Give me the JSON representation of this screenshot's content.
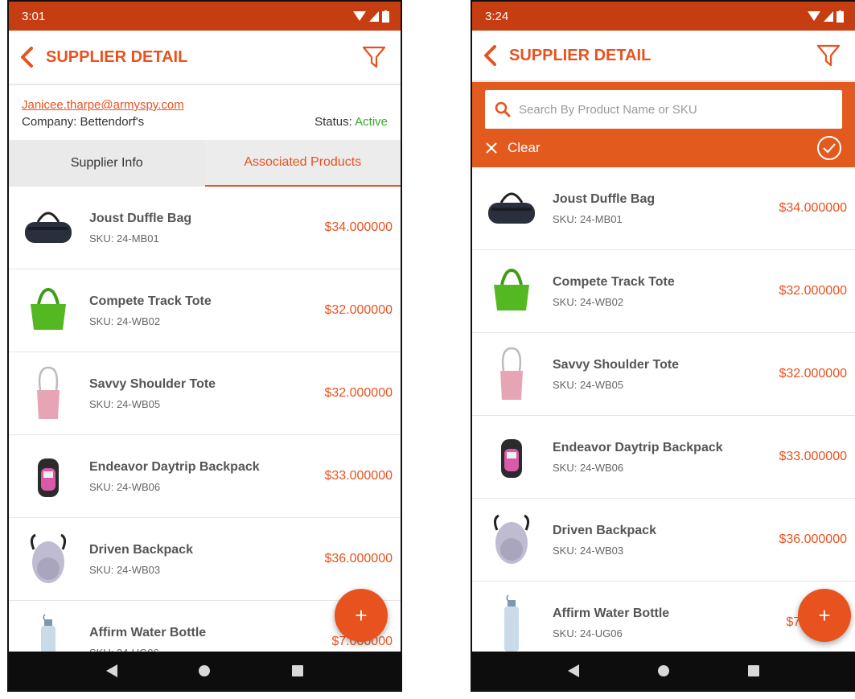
{
  "left": {
    "status_time": "3:01",
    "title": "SUPPLIER DETAIL",
    "email": "Janicee.tharpe@armyspy.com",
    "company": "Company: Bettendorf's",
    "status_label": "Status:",
    "status_value": "Active",
    "tabs": [
      "Supplier Info",
      "Associated Products"
    ],
    "fab_label": "+"
  },
  "right": {
    "status_time": "3:24",
    "title": "SUPPLIER DETAIL",
    "search_placeholder": "Search By Product Name or SKU",
    "clear_label": "Clear",
    "fab_label": "+"
  },
  "products": [
    {
      "name": "Joust Duffle Bag",
      "sku": "SKU: 24-MB01",
      "price": "$34.000000",
      "icon": "duffle-bag"
    },
    {
      "name": "Compete Track Tote",
      "sku": "SKU: 24-WB02",
      "price": "$32.000000",
      "icon": "tote-green"
    },
    {
      "name": "Savvy Shoulder Tote",
      "sku": "SKU: 24-WB05",
      "price": "$32.000000",
      "icon": "tote-pink"
    },
    {
      "name": "Endeavor Daytrip Backpack",
      "sku": "SKU: 24-WB06",
      "price": "$33.000000",
      "icon": "backpack-pink"
    },
    {
      "name": "Driven Backpack",
      "sku": "SKU: 24-WB03",
      "price": "$36.000000",
      "icon": "backpack-grey"
    },
    {
      "name": "Affirm Water Bottle",
      "sku": "SKU: 24-UG06",
      "price": "$7.000000",
      "icon": "water-bottle"
    }
  ],
  "colors": {
    "accent": "#e8521f",
    "statusbar": "#c63d12",
    "active": "#3aa82c"
  }
}
